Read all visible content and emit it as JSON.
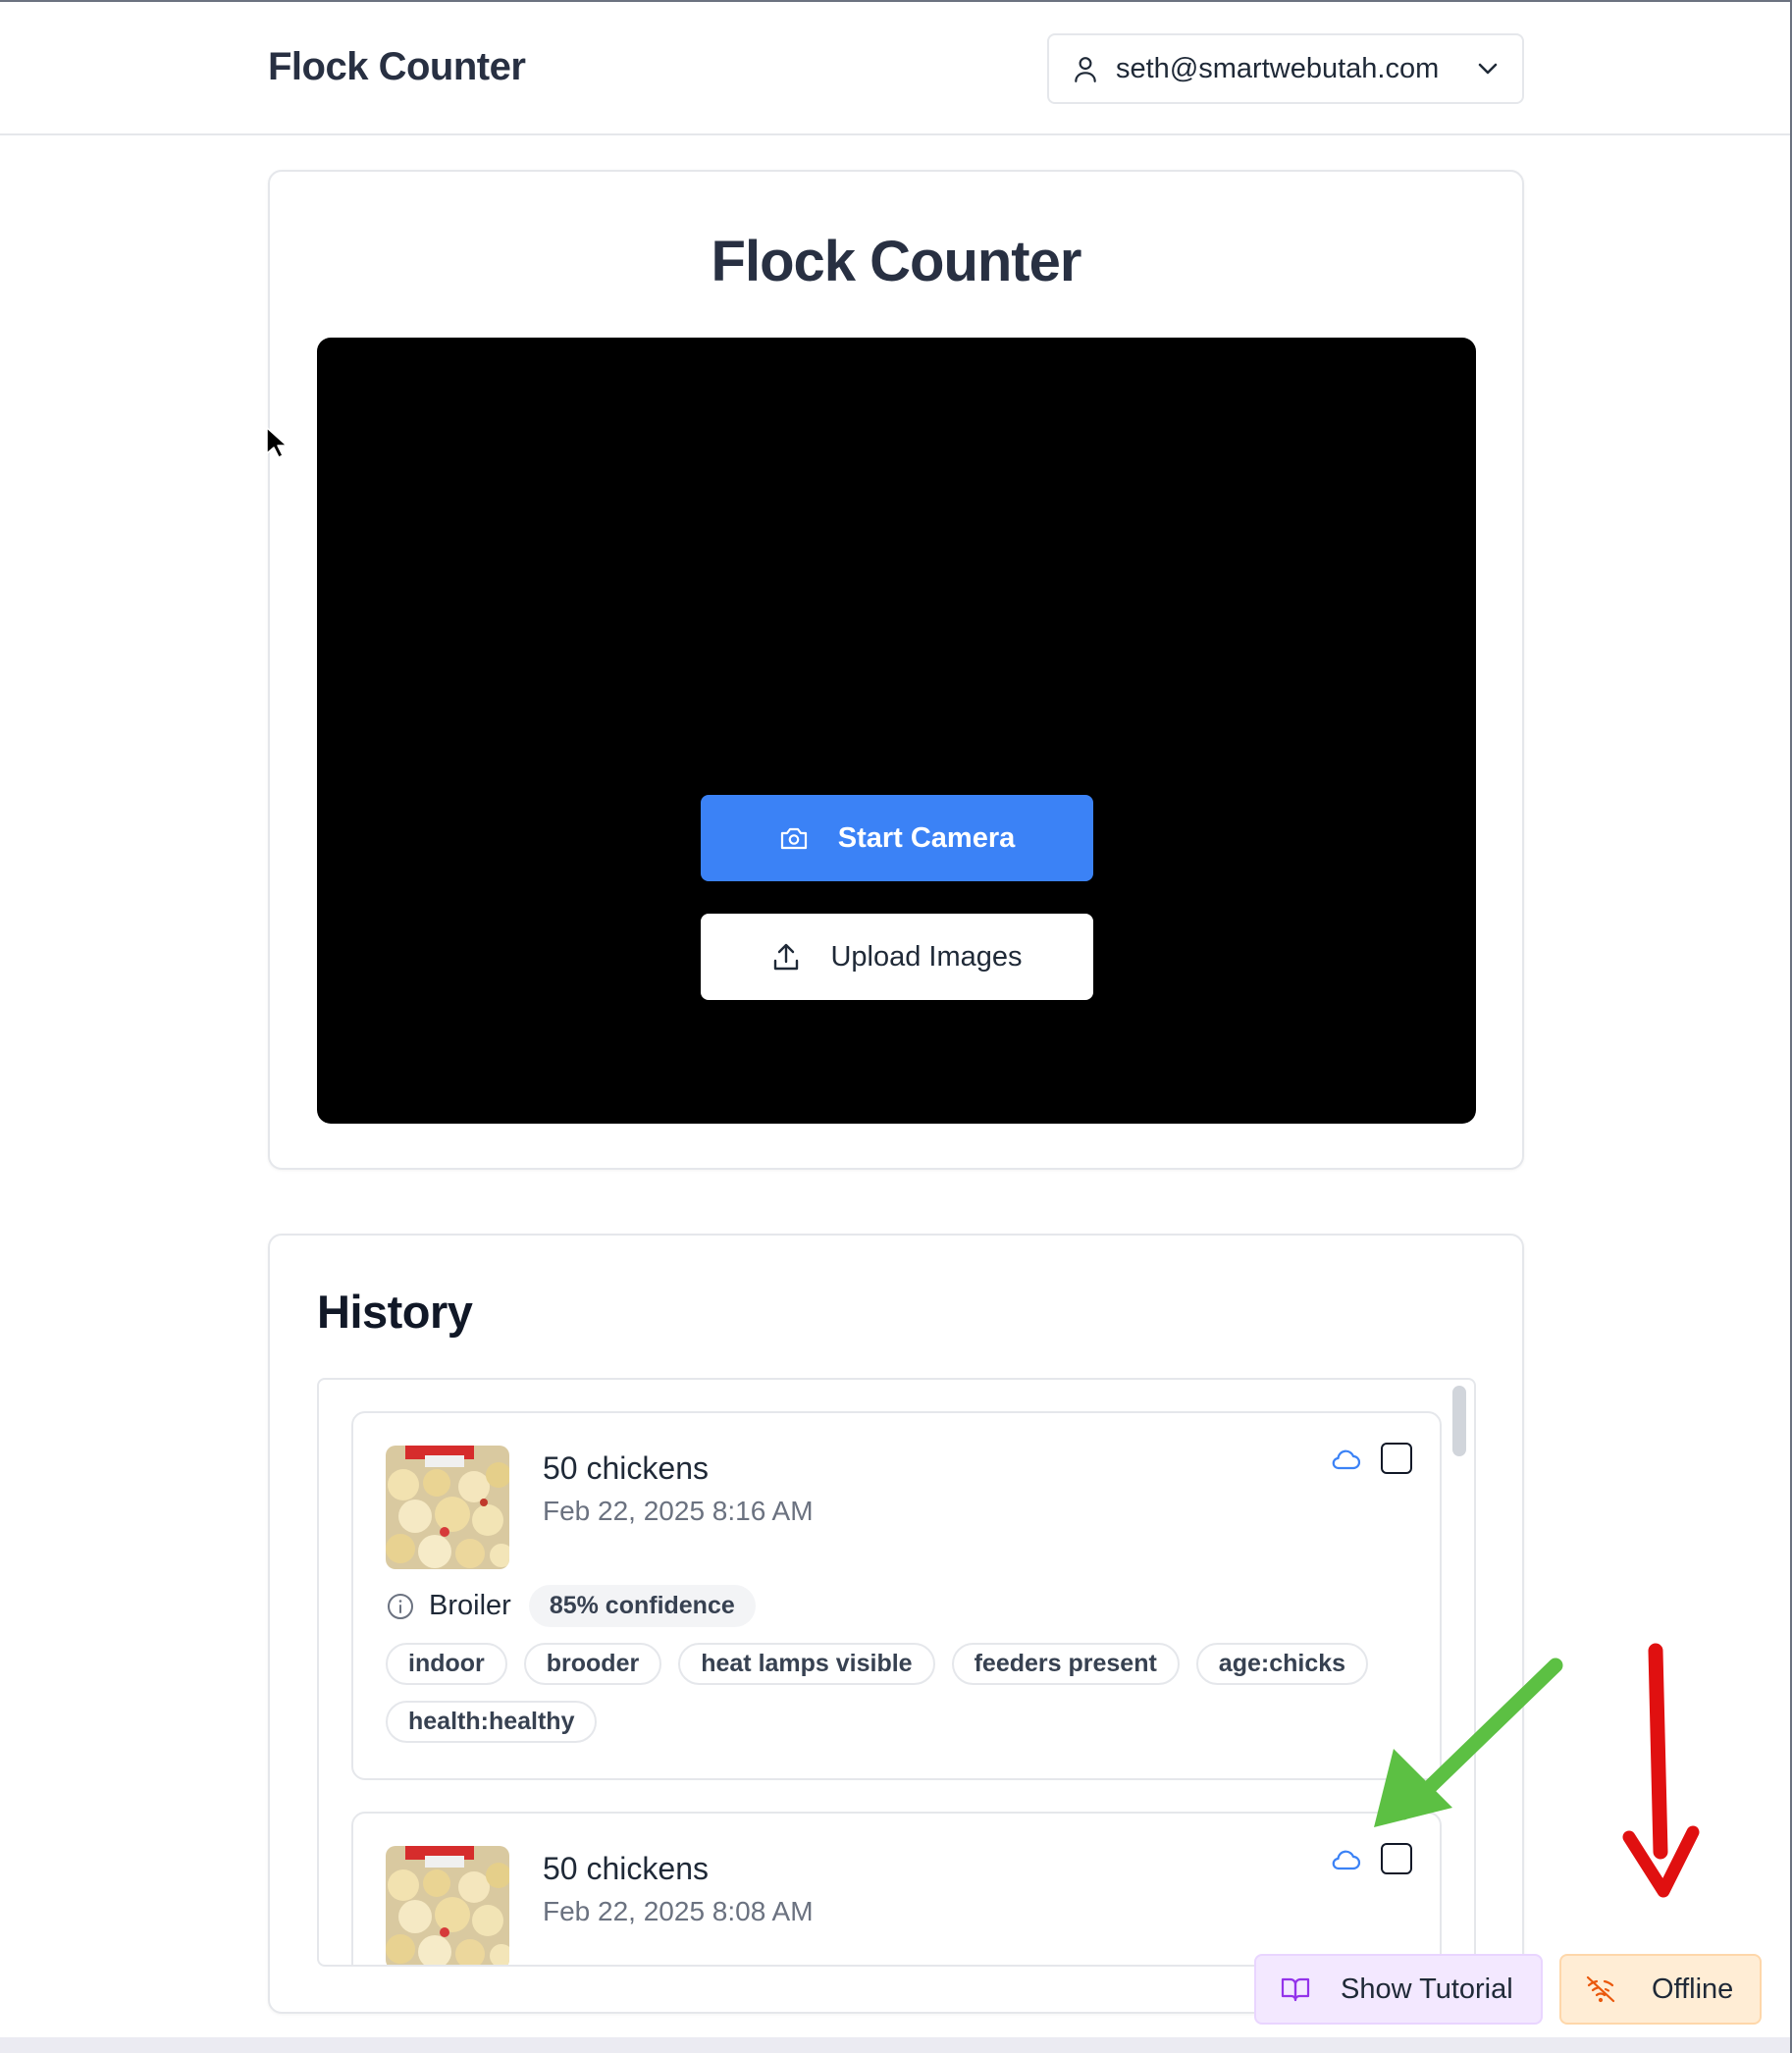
{
  "header": {
    "app_title": "Flock Counter",
    "user_email": "seth@smartwebutah.com"
  },
  "camera_card": {
    "title": "Flock Counter",
    "start_camera_label": "Start Camera",
    "upload_images_label": "Upload Images"
  },
  "history": {
    "title": "History",
    "entries": [
      {
        "count": "50 chickens",
        "date": "Feb 22, 2025 8:16 AM",
        "breed": "Broiler",
        "confidence": "85% confidence",
        "tags": [
          "indoor",
          "brooder",
          "heat lamps visible",
          "feeders present",
          "age:chicks",
          "health:healthy"
        ]
      },
      {
        "count": "50 chickens",
        "date": "Feb 22, 2025 8:08 AM"
      }
    ]
  },
  "floating": {
    "tutorial_label": "Show Tutorial",
    "offline_label": "Offline"
  },
  "colors": {
    "primary": "#3b82f6",
    "tutorial_bg": "#f3e8ff",
    "offline_bg": "#ffedd5",
    "annotation_green": "#5cc043",
    "annotation_red": "#e01010"
  }
}
